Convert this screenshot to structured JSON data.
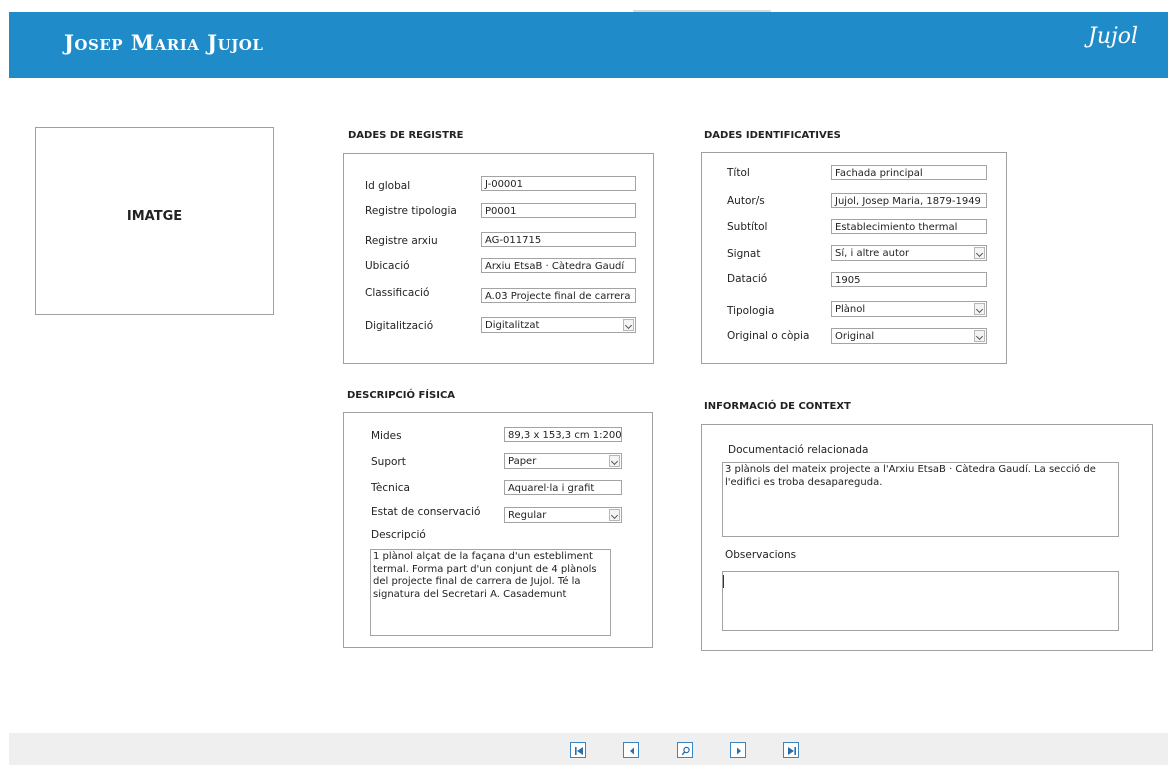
{
  "header": {
    "title": "Josep Maria Jujol",
    "signature": "Jujol"
  },
  "image_placeholder": "IMATGE",
  "dades_registre": {
    "title": "DADES DE REGISTRE",
    "id_global_label": "Id global",
    "id_global_value": "J-00001",
    "registre_tipologia_label": "Registre tipologia",
    "registre_tipologia_value": "P0001",
    "registre_arxiu_label": "Registre arxiu",
    "registre_arxiu_value": "AG-011715",
    "ubicacio_label": "Ubicació",
    "ubicacio_value": "Arxiu EtsaB · Càtedra Gaudí",
    "classificacio_label": "Classificació",
    "classificacio_value": "A.03 Projecte final de carrera",
    "digitalitzacio_label": "Digitalització",
    "digitalitzacio_value": "Digitalitzat"
  },
  "dades_identificatives": {
    "title": "DADES IDENTIFICATIVES",
    "titol_label": "Títol",
    "titol_value": "Fachada principal",
    "autors_label": "Autor/s",
    "autors_value": "Jujol, Josep Maria, 1879-1949",
    "subtitol_label": "Subtítol",
    "subtitol_value": "Establecimiento thermal",
    "signat_label": "Signat",
    "signat_value": "Sí, i altre autor",
    "datacio_label": "Datació",
    "datacio_value": "1905",
    "tipologia_label": "Tipologia",
    "tipologia_value": "Plànol",
    "original_label": "Original o còpia",
    "original_value": "Original"
  },
  "descripcio_fisica": {
    "title": "DESCRIPCIÓ FÍSICA",
    "mides_label": "Mides",
    "mides_value": "89,3 x 153,3 cm 1:200",
    "suport_label": "Suport",
    "suport_value": "Paper",
    "tecnica_label": "Tècnica",
    "tecnica_value": "Aquarel·la i grafit",
    "estat_label": "Estat de conservació",
    "estat_value": "Regular",
    "descripcio_label": "Descripció",
    "descripcio_value": "1 plànol alçat de la façana d'un estebliment termal. Forma part d'un conjunt de 4 plànols del projecte final de carrera de Jujol. Té la signatura del Secretari A. Casademunt"
  },
  "context": {
    "title": "INFORMACIÓ DE CONTEXT",
    "documentacio_label": "Documentació relacionada",
    "documentacio_value": "3 plànols del mateix projecte a l'Arxiu EtsaB · Càtedra Gaudí. La secció de l'edifici es troba desapareguda.",
    "observacions_label": "Observacions",
    "observacions_value": ""
  },
  "footer_nav": [
    "first-record-icon",
    "previous-record-icon",
    "search-icon",
    "next-record-icon",
    "last-record-icon"
  ],
  "colors": {
    "header": "#1f8cc9",
    "nav_border": "#3a85c0",
    "footer": "#efefef"
  }
}
